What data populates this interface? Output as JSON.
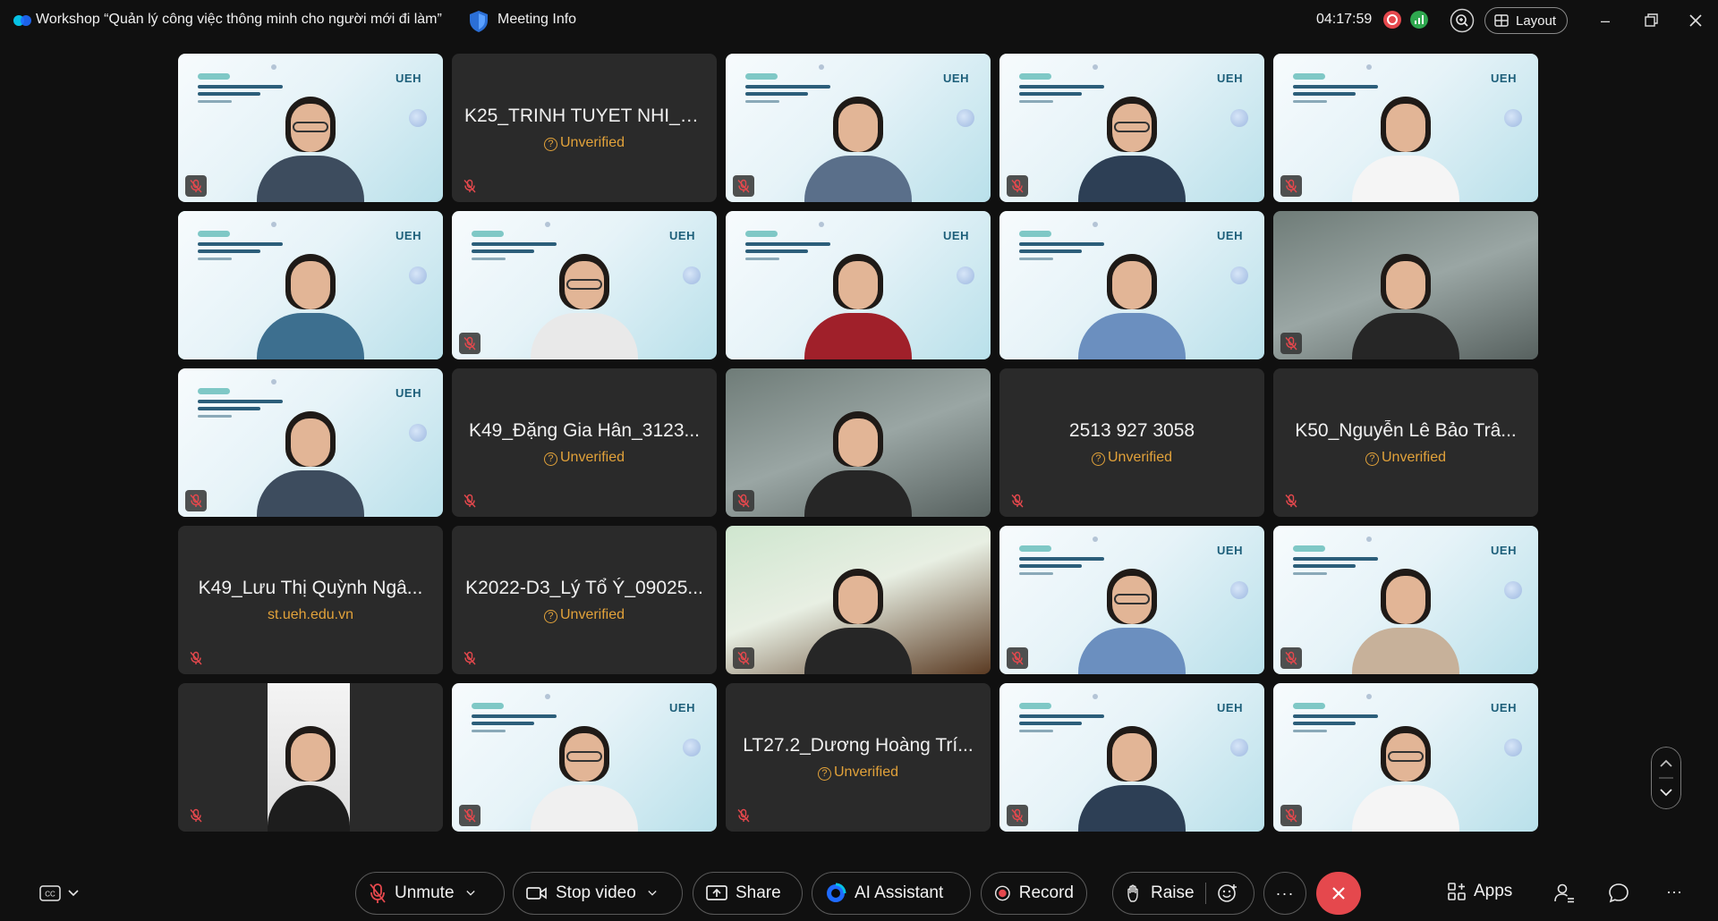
{
  "titlebar": {
    "title": "Workshop “Quản lý công việc thông minh cho người mới đi làm”",
    "meeting_info": "Meeting Info",
    "time": "04:17:59",
    "layout_label": "Layout"
  },
  "tiles": [
    {
      "kind": "slide",
      "muted": true
    },
    {
      "kind": "name",
      "name": "K25_TRINH TUYET NHI_0...",
      "status": "Unverified",
      "muted": true
    },
    {
      "kind": "slide",
      "muted": true
    },
    {
      "kind": "slide",
      "muted": true
    },
    {
      "kind": "slide",
      "muted": true
    },
    {
      "kind": "slide",
      "active": true,
      "muted": false
    },
    {
      "kind": "slide",
      "muted": true
    },
    {
      "kind": "slide",
      "muted": false
    },
    {
      "kind": "slide",
      "muted": false
    },
    {
      "kind": "photo",
      "muted": true
    },
    {
      "kind": "slide",
      "muted": true
    },
    {
      "kind": "name",
      "name": "K49_Đặng Gia Hân_3123...",
      "status": "Unverified",
      "muted": true
    },
    {
      "kind": "photo",
      "muted": true
    },
    {
      "kind": "name",
      "name": "2513 927 3058",
      "status": "Unverified",
      "muted": true
    },
    {
      "kind": "name",
      "name": "K50_Nguyễn Lê Bảo Trâ...",
      "status": "Unverified",
      "muted": true
    },
    {
      "kind": "name",
      "name": "K49_Lưu Thị Quỳnh Ngâ...",
      "domain": "st.ueh.edu.vn",
      "muted": true
    },
    {
      "kind": "name",
      "name": "K2022-D3_Lý Tổ Ý_09025...",
      "status": "Unverified",
      "muted": true
    },
    {
      "kind": "photo",
      "muted": true
    },
    {
      "kind": "slide",
      "muted": true
    },
    {
      "kind": "slide",
      "muted": true
    },
    {
      "kind": "narrow",
      "muted": true
    },
    {
      "kind": "slide",
      "muted": true
    },
    {
      "kind": "name",
      "name": "LT27.2_Dương Hoàng Trí...",
      "status": "Unverified",
      "muted": true
    },
    {
      "kind": "slide",
      "muted": true
    },
    {
      "kind": "slide",
      "muted": true
    }
  ],
  "slide_logo": "UEH",
  "controls": {
    "unmute": "Unmute",
    "stop_video": "Stop video",
    "share": "Share",
    "ai_assistant": "AI Assistant",
    "record": "Record",
    "raise": "Raise",
    "more": "···",
    "apps": "Apps",
    "overflow": "···"
  },
  "colors": {
    "end_call": "#e5484d",
    "unverified": "#e2a23a",
    "active_border": "#5fd4c9",
    "tile_bg": "#2a2a2a"
  }
}
